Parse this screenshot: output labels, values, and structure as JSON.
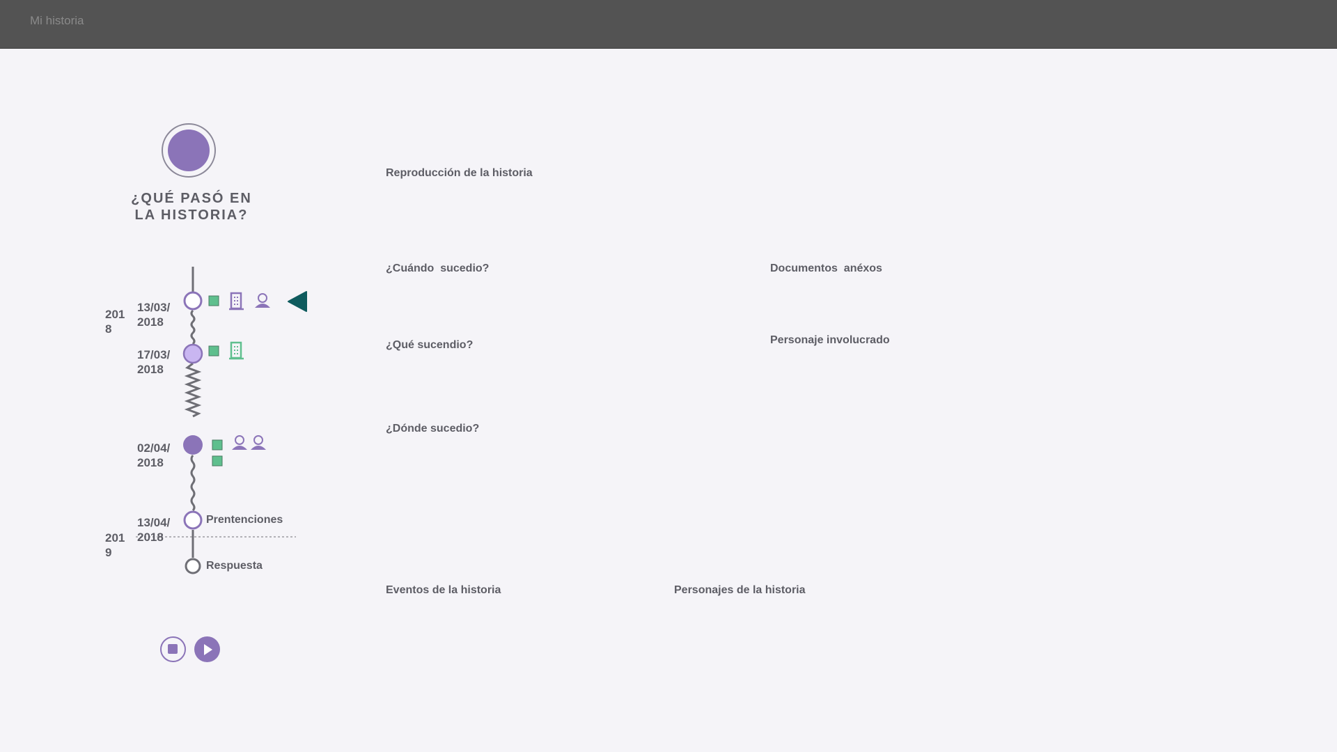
{
  "app": {
    "title": "Mi historia"
  },
  "story": {
    "question": "¿QUÉ PASÓ EN LA HISTORIA?"
  },
  "timeline": {
    "years": [
      "2018",
      "2019"
    ],
    "events": [
      {
        "date": "13/03/2018",
        "label": "",
        "icons": [
          "document-icon",
          "building-icon",
          "person-icon",
          "pointer-icon"
        ]
      },
      {
        "date": "17/03/2018",
        "label": "",
        "icons": [
          "document-icon",
          "building-icon"
        ]
      },
      {
        "date": "02/04/2018",
        "label": "",
        "icons": [
          "document-icon",
          "document-icon",
          "person-icon",
          "person-icon"
        ]
      },
      {
        "date": "13/04/2018",
        "label": "Prentenciones",
        "icons": []
      },
      {
        "date": "",
        "label": "Respuesta",
        "icons": []
      }
    ]
  },
  "sections": {
    "playback": "Reproducción de la historia",
    "when": "¿Cuándo  sucedio?",
    "what": "¿Qué sucendio?",
    "where": "¿Dónde sucedio?",
    "documents": "Documentos  anéxos",
    "character": "Personaje involucrado",
    "events": "Eventos de la historia",
    "characters": "Personajes de la historia"
  },
  "controls": {
    "stop_icon": "stop-icon",
    "play_icon": "play-icon"
  },
  "colors": {
    "header": "#535353",
    "background": "#f5f4f8",
    "purple": "#8b74b8",
    "light_purple": "#c9b6f1",
    "green": "#5fbf8e",
    "teal": "#0f5b5e",
    "line": "#6e6e75"
  }
}
